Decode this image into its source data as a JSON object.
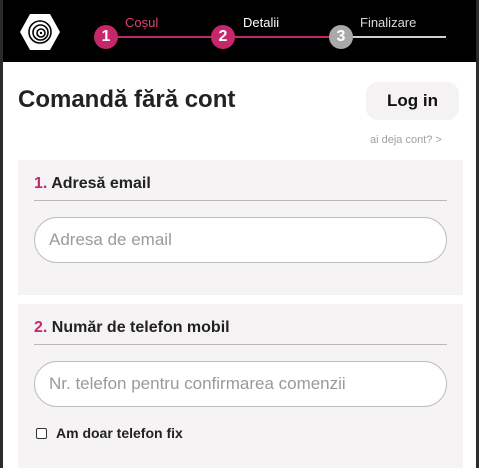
{
  "header": {
    "logo_icon": "spiral-hexagon-logo-icon",
    "steps": [
      {
        "number": "1",
        "label": "Coșul",
        "state": "done"
      },
      {
        "number": "2",
        "label": "Detalii",
        "state": "current"
      },
      {
        "number": "3",
        "label": "Finalizare",
        "state": "pending"
      }
    ]
  },
  "main": {
    "title": "Comandă fără cont",
    "login_label": "Log in",
    "have_account": "ai deja cont? >"
  },
  "email_section": {
    "number": "1.",
    "title": "Adresă email",
    "placeholder": "Adresa de email"
  },
  "phone_section": {
    "number": "2.",
    "title": "Număr de telefon mobil",
    "placeholder": "Nr. telefon pentru confirmarea comenzii",
    "checkbox_label": "Am doar telefon fix",
    "checkbox_checked": false
  },
  "colors": {
    "accent": "#c4286b",
    "header_bg": "#000000",
    "section_bg": "#f5f3f3"
  }
}
